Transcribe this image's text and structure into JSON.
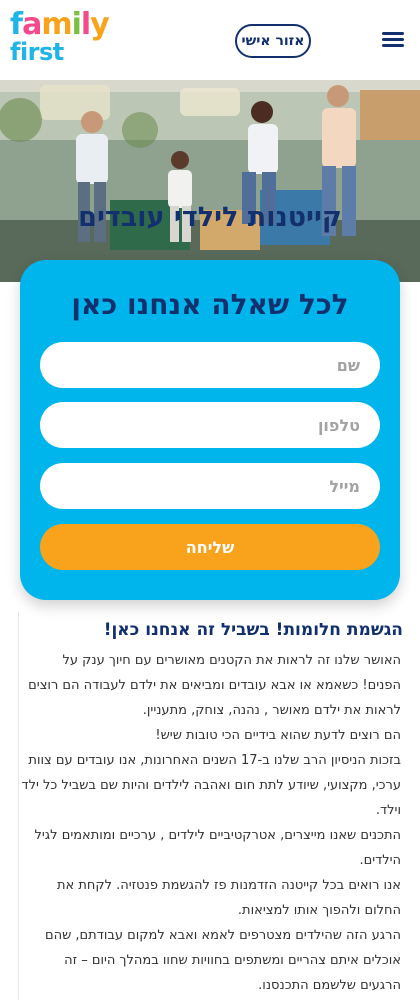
{
  "header": {
    "logo_line1": "family",
    "logo_line2": "first",
    "personal_area_label": "אזור אישי",
    "menu_icon": "hamburger-icon"
  },
  "hero": {
    "title": "קייטנות לילדי עובדים"
  },
  "form": {
    "title": "לכל שאלה אנחנו כאן",
    "name_placeholder": "שם",
    "phone_placeholder": "טלפון",
    "email_placeholder": "מייל",
    "submit_label": "שליחה"
  },
  "content": {
    "title": "הגשמת חלומות! בשביל זה אנחנו כאן!",
    "paragraphs": [
      "האושר שלנו זה לראות את הקטנים מאושרים עם חיוך ענק על הפנים! כשאמא או אבא עובדים ומביאים את ילדם לעבודה הם רוצים לראות את ילדם מאושר , נהנה, צוחק, מתעניין.",
      "הם רוצים לדעת שהוא בידיים הכי טובות שיש!",
      "בזכות הניסיון הרב שלנו ב-17 השנים האחרונות, אנו עובדים עם צוות ערכי, מקצועי, שיודע לתת חום ואהבה לילדים והיות שם בשביל כל ילד וילד.",
      "התכנים שאנו מייצרים, אטרקטיביים לילדים , ערכיים ומותאמים לגיל הילדים.",
      "אנו רואים בכל קייטנה הזדמנות פז להגשמת פנטזיה. לקחת את החלום ולהפוך אותו למציאות.",
      "הרגע הזה שהילדים מצטרפים לאמא ואבא למקום עבודתם, שהם אוכלים איתם צהריים ומשתפים בחוויות שחוו במהלך היום – זה הרגעים שלשמם התכנסנו."
    ]
  },
  "colors": {
    "navy": "#13306e",
    "cyan": "#00b5ec",
    "orange": "#f8a31b"
  }
}
